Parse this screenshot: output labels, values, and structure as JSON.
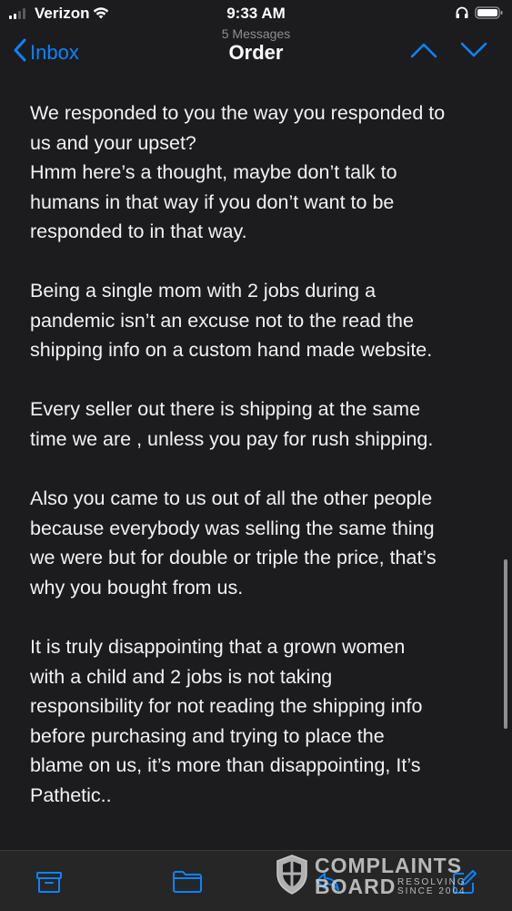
{
  "status_bar": {
    "carrier": "Verizon",
    "time": "9:33 AM",
    "signal_bars": 4,
    "signal_bars_active": 2,
    "icons": [
      "wifi-icon",
      "headphones-icon",
      "battery-icon"
    ]
  },
  "nav": {
    "back_label": "Inbox",
    "message_count": "5 Messages",
    "title": "Order",
    "icons": [
      "chevron-left-icon",
      "chevron-up-icon",
      "chevron-down-icon"
    ],
    "accent_color": "#0a84ff"
  },
  "message": {
    "paragraphs": [
      {
        "lines": [
          "We responded to you the way you responded to",
          "us and your upset?",
          "Hmm here’s a thought, maybe don’t talk to",
          "humans  in that way if you don’t want to be",
          "responded to in that way."
        ]
      },
      {
        "lines": [
          "Being a single mom with 2 jobs during a",
          "pandemic isn’t an excuse not to the read the",
          "shipping info on a custom hand made website."
        ]
      },
      {
        "lines": [
          "Every seller out there is shipping at the same",
          "time we are , unless you pay for rush shipping."
        ]
      },
      {
        "lines": [
          "Also you came to us out of all the other people",
          "because everybody was selling the same thing",
          "we were but for double or triple the price, that’s",
          "why you bought from us."
        ]
      },
      {
        "lines": [
          "It is truly disappointing that a grown women",
          "with a child and 2 jobs is not taking",
          "responsibility for not reading the shipping info",
          "before purchasing and trying to place the",
          "blame on us, it’s more than disappointing, It’s",
          "Pathetic.."
        ]
      }
    ]
  },
  "toolbar": {
    "icons": [
      "archive-icon",
      "folder-icon",
      "reply-icon",
      "compose-icon"
    ]
  },
  "watermark": {
    "line1": "COMPLAINTS",
    "line2": "BOARD",
    "tag1": "RESOLVING",
    "tag2": "SINCE 2004"
  },
  "colors": {
    "background": "#1c1c1e",
    "text": "#f2f2f2",
    "secondary_text": "#8e8e93",
    "accent": "#0a84ff"
  }
}
